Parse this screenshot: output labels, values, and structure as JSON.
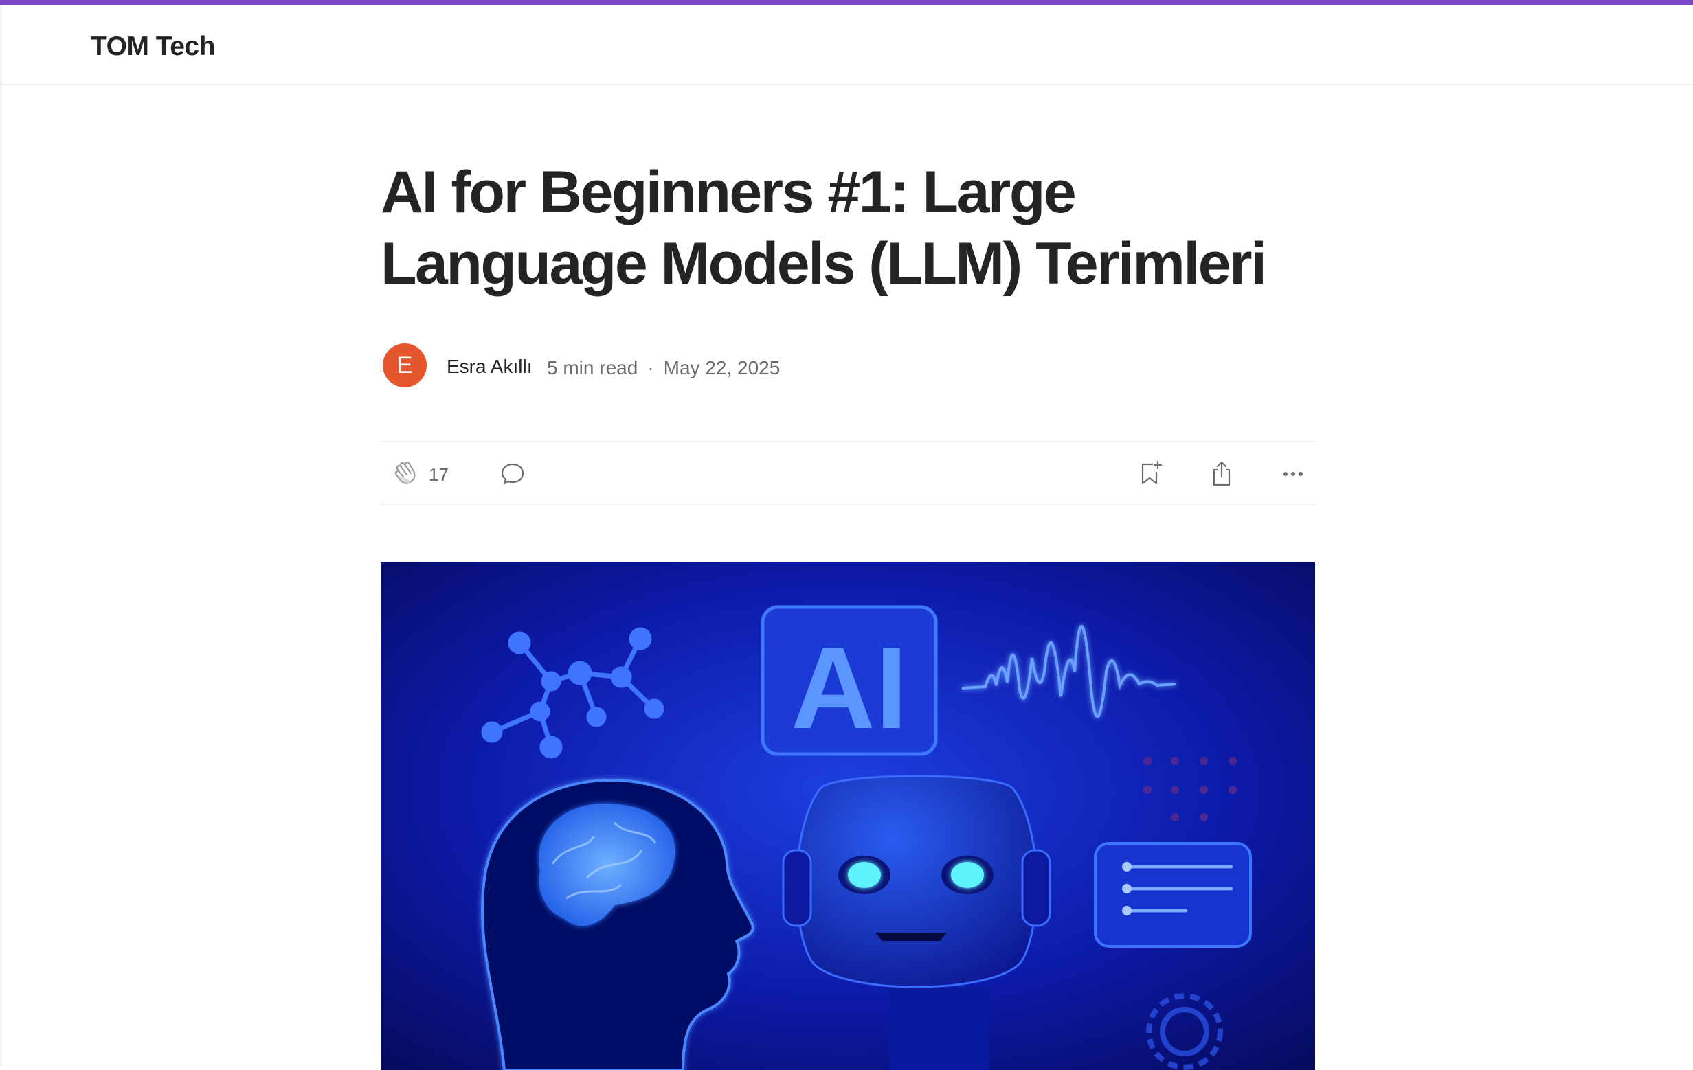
{
  "publication": {
    "name": "TOM Tech"
  },
  "article": {
    "title": "AI for Beginners #1: Large Language Models (LLM) Terimleri",
    "author": {
      "name": "Esra Akıllı",
      "initial": "E"
    },
    "read_time": "5 min read",
    "separator": "·",
    "date": "May 22, 2025"
  },
  "actions": {
    "clap_count": "17",
    "icons": [
      "clap-icon",
      "comment-icon",
      "bookmark-add-icon",
      "share-icon",
      "more-options-icon"
    ]
  },
  "hero_image": {
    "badge_text": "AI"
  },
  "colors": {
    "accent": "#7b47c9",
    "avatar": "#e4572e",
    "text": "#242424",
    "muted": "#6b6b6b"
  }
}
